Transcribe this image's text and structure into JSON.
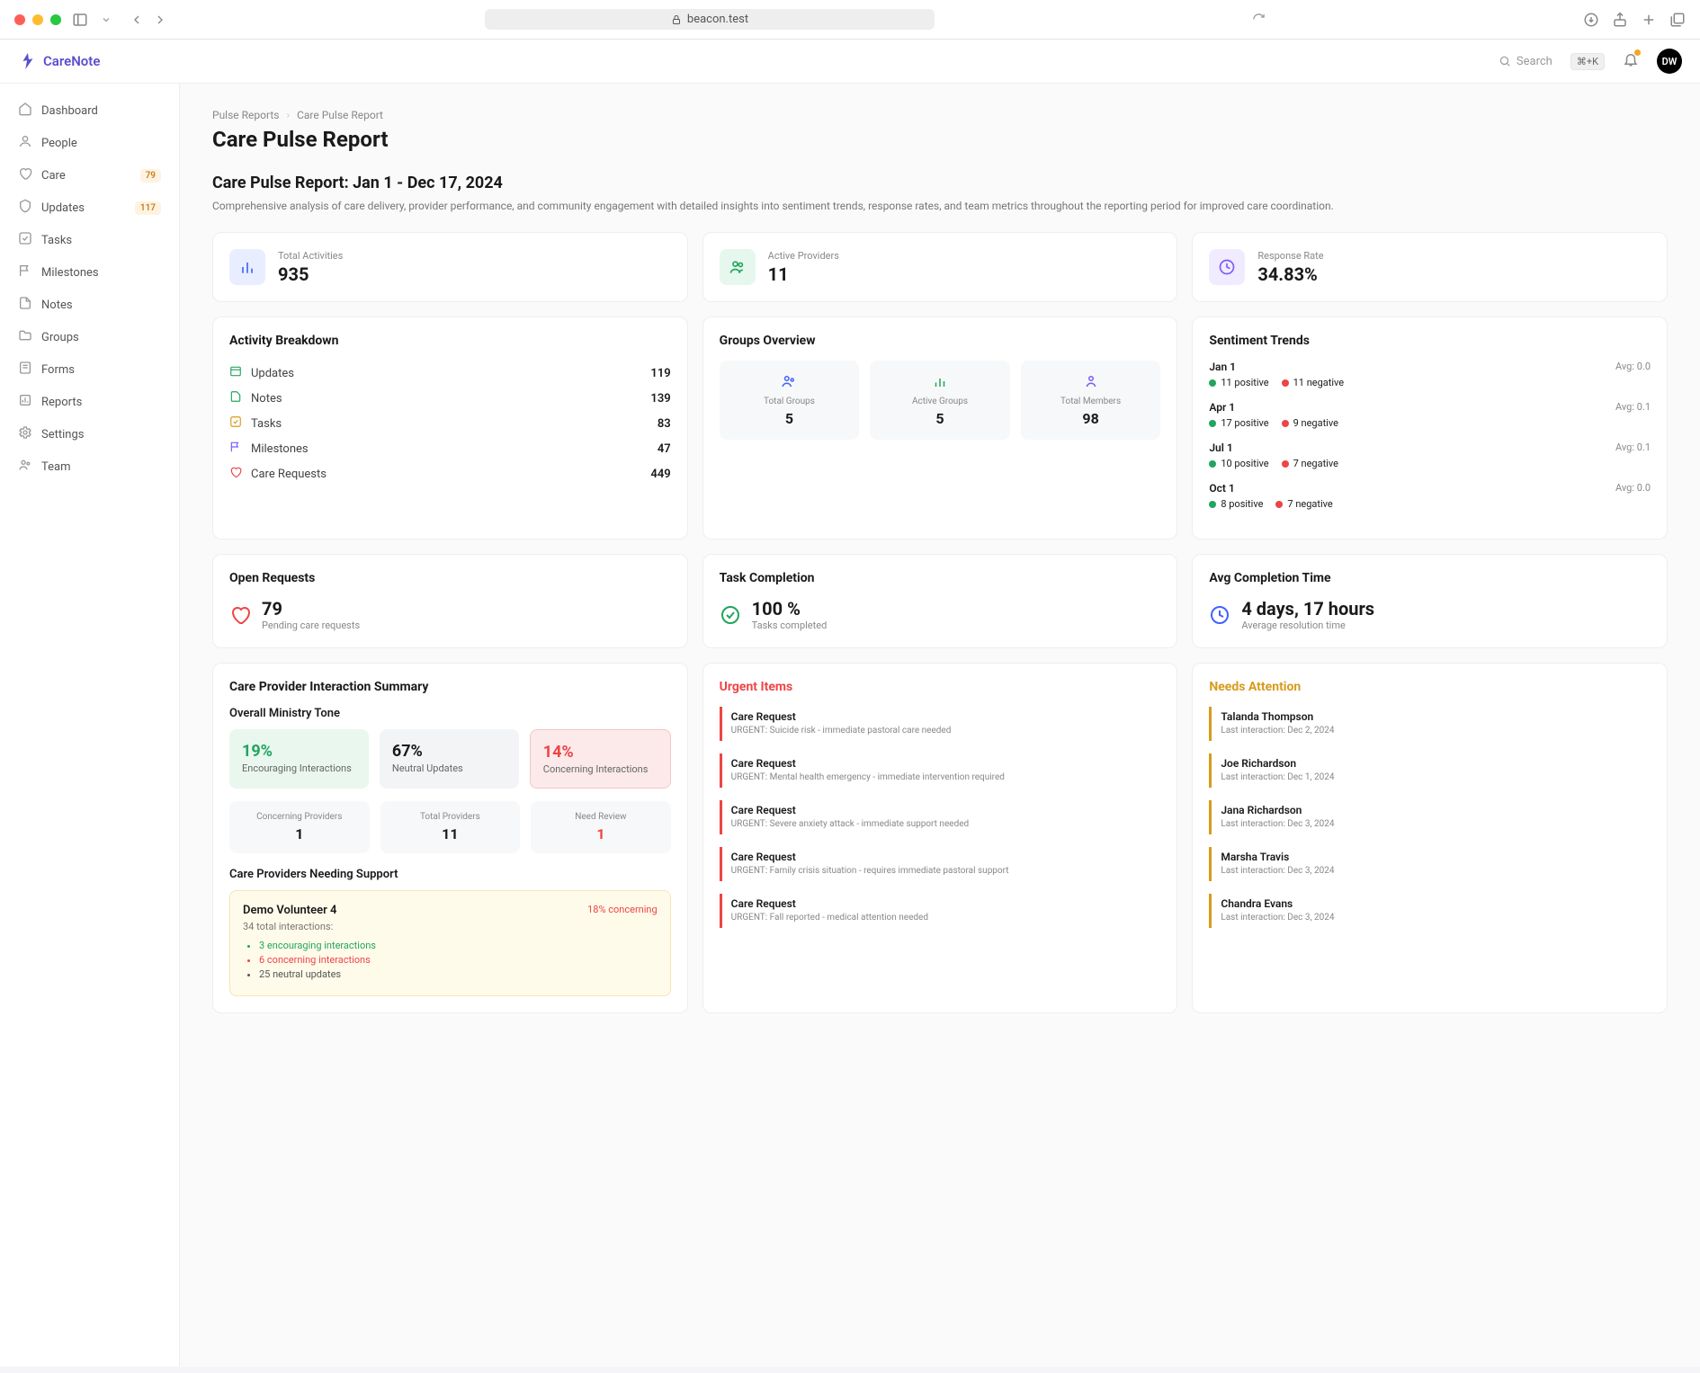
{
  "browser": {
    "url": "beacon.test"
  },
  "header": {
    "logo_text": "CareNote",
    "search_placeholder": "Search",
    "kbd": "⌘+K",
    "avatar": "DW"
  },
  "sidebar": {
    "items": [
      {
        "label": "Dashboard",
        "icon": "home"
      },
      {
        "label": "People",
        "icon": "users"
      },
      {
        "label": "Care",
        "icon": "heart",
        "badge": "79"
      },
      {
        "label": "Updates",
        "icon": "shield",
        "badge": "117"
      },
      {
        "label": "Tasks",
        "icon": "check"
      },
      {
        "label": "Milestones",
        "icon": "flag"
      },
      {
        "label": "Notes",
        "icon": "file"
      },
      {
        "label": "Groups",
        "icon": "folder"
      },
      {
        "label": "Forms",
        "icon": "form"
      },
      {
        "label": "Reports",
        "icon": "report"
      },
      {
        "label": "Settings",
        "icon": "gear"
      },
      {
        "label": "Team",
        "icon": "team"
      }
    ]
  },
  "breadcrumb": {
    "root": "Pulse Reports",
    "current": "Care Pulse Report"
  },
  "page": {
    "title": "Care Pulse Report",
    "report_title": "Care Pulse Report: Jan 1 - Dec 17, 2024",
    "report_desc": "Comprehensive analysis of care delivery, provider performance, and community engagement with detailed insights into sentiment trends, response rates, and team metrics throughout the reporting period for improved care coordination."
  },
  "stats": {
    "activities": {
      "label": "Total Activities",
      "value": "935"
    },
    "providers": {
      "label": "Active Providers",
      "value": "11"
    },
    "response": {
      "label": "Response Rate",
      "value": "34.83%"
    }
  },
  "breakdown": {
    "title": "Activity Breakdown",
    "rows": [
      {
        "label": "Updates",
        "value": "119",
        "color": "#22a55e"
      },
      {
        "label": "Notes",
        "value": "139",
        "color": "#22a55e"
      },
      {
        "label": "Tasks",
        "value": "83",
        "color": "#d89b1c"
      },
      {
        "label": "Milestones",
        "value": "47",
        "color": "#7a5af8"
      },
      {
        "label": "Care Requests",
        "value": "449",
        "color": "#ef4444"
      }
    ]
  },
  "groups": {
    "title": "Groups Overview",
    "boxes": [
      {
        "label": "Total Groups",
        "value": "5",
        "color": "#4262ff"
      },
      {
        "label": "Active Groups",
        "value": "5",
        "color": "#22a55e"
      },
      {
        "label": "Total Members",
        "value": "98",
        "color": "#7a5af8"
      }
    ]
  },
  "sentiment": {
    "title": "Sentiment Trends",
    "rows": [
      {
        "date": "Jan 1",
        "avg": "Avg: 0.0",
        "pos": "11 positive",
        "neg": "11 negative"
      },
      {
        "date": "Apr 1",
        "avg": "Avg: 0.1",
        "pos": "17 positive",
        "neg": "9 negative"
      },
      {
        "date": "Jul 1",
        "avg": "Avg: 0.1",
        "pos": "10 positive",
        "neg": "7 negative"
      },
      {
        "date": "Oct 1",
        "avg": "Avg: 0.0",
        "pos": "8 positive",
        "neg": "7 negative"
      }
    ]
  },
  "open_requests": {
    "title": "Open Requests",
    "value": "79",
    "sub": "Pending care requests"
  },
  "task_completion": {
    "title": "Task Completion",
    "value": "100 %",
    "sub": "Tasks completed"
  },
  "avg_time": {
    "title": "Avg Completion Time",
    "value": "4 days, 17 hours",
    "sub": "Average resolution time"
  },
  "interaction": {
    "title": "Care Provider Interaction Summary",
    "tone_title": "Overall Ministry Tone",
    "tones": [
      {
        "pct": "19%",
        "label": "Encouraging Interactions",
        "cls": "g"
      },
      {
        "pct": "67%",
        "label": "Neutral Updates",
        "cls": "n"
      },
      {
        "pct": "14%",
        "label": "Concerning Interactions",
        "cls": "r"
      }
    ],
    "provs": [
      {
        "label": "Concerning Providers",
        "value": "1",
        "cls": ""
      },
      {
        "label": "Total Providers",
        "value": "11",
        "cls": ""
      },
      {
        "label": "Need Review",
        "value": "1",
        "cls": "r"
      }
    ],
    "support_title": "Care Providers Needing Support",
    "support": {
      "name": "Demo Volunteer 4",
      "pct": "18% concerning",
      "sub": "34 total interactions:",
      "lines": [
        {
          "text": "3 encouraging interactions",
          "cls": "li-g"
        },
        {
          "text": "6 concerning interactions",
          "cls": "li-r"
        },
        {
          "text": "25 neutral updates",
          "cls": "li-n"
        }
      ]
    }
  },
  "urgent": {
    "title": "Urgent Items",
    "items": [
      {
        "title": "Care Request",
        "sub": "URGENT: Suicide risk - immediate pastoral care needed"
      },
      {
        "title": "Care Request",
        "sub": "URGENT: Mental health emergency - immediate intervention required"
      },
      {
        "title": "Care Request",
        "sub": "URGENT: Severe anxiety attack - immediate support needed"
      },
      {
        "title": "Care Request",
        "sub": "URGENT: Family crisis situation - requires immediate pastoral support"
      },
      {
        "title": "Care Request",
        "sub": "URGENT: Fall reported - medical attention needed"
      }
    ]
  },
  "attention": {
    "title": "Needs Attention",
    "items": [
      {
        "title": "Talanda Thompson",
        "sub": "Last interaction: Dec 2, 2024"
      },
      {
        "title": "Joe Richardson",
        "sub": "Last interaction: Dec 1, 2024"
      },
      {
        "title": "Jana Richardson",
        "sub": "Last interaction: Dec 3, 2024"
      },
      {
        "title": "Marsha Travis",
        "sub": "Last interaction: Dec 3, 2024"
      },
      {
        "title": "Chandra Evans",
        "sub": "Last interaction: Dec 3, 2024"
      }
    ]
  }
}
